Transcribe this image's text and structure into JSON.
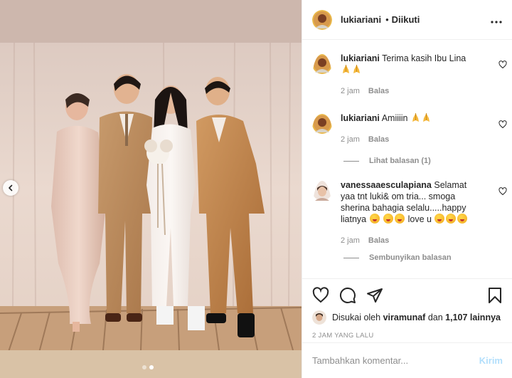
{
  "post": {
    "username": "lukiariani",
    "separator": "•",
    "follow_status": "Diikuti",
    "more_icon": "more-horizontal-icon"
  },
  "carousel": {
    "slide_count": 2,
    "active_slide": 2
  },
  "comments": [
    {
      "username": "lukiariani",
      "text": "Terima kasih Ibu Lina",
      "emoji": [
        "folded-hands",
        "folded-hands"
      ],
      "time": "2 jam",
      "reply_label": "Balas"
    },
    {
      "username": "lukiariani",
      "text": "Amiiiin",
      "emoji": [
        "folded-hands",
        "folded-hands"
      ],
      "time": "2 jam",
      "reply_label": "Balas",
      "replies_toggle": "Lihat balasan (1)"
    },
    {
      "username": "vanessaaesculapiana",
      "text_parts": [
        "Selamat yaa tnt luki& om tria... smoga sherina bahagia selalu.....happy liatnya",
        "love u"
      ],
      "time": "2 jam",
      "reply_label": "Balas",
      "replies_toggle": "Sembunyikan balasan"
    }
  ],
  "likes": {
    "prefix": "Disukai oleh",
    "user": "viramunaf",
    "joiner": "dan",
    "count": "1,107 lainnya"
  },
  "timestamp": "2 JAM YANG LALU",
  "add_comment": {
    "placeholder": "Tambahkan komentar...",
    "post_label": "Kirim"
  },
  "colors": {
    "text": "#262626",
    "secondary": "#8e8e8e",
    "post_button_disabled": "#b2dffc",
    "border": "#efefef"
  }
}
